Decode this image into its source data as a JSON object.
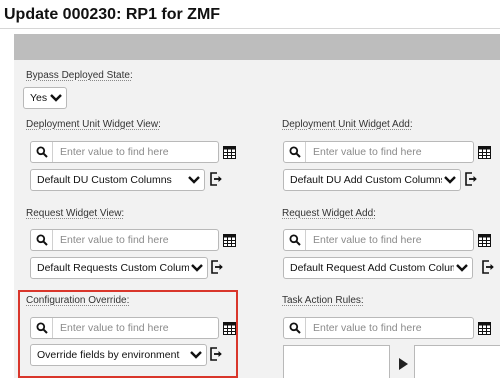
{
  "page": {
    "title": "Update  000230: RP1 for ZMF"
  },
  "bypass": {
    "label": "Bypass Deployed State:",
    "value": "Yes"
  },
  "du_view": {
    "label": "Deployment Unit Widget View:",
    "placeholder": "Enter value to find here",
    "selected": "Default DU Custom Columns"
  },
  "du_add": {
    "label": "Deployment Unit Widget Add:",
    "placeholder": "Enter value to find here",
    "selected": "Default DU Add Custom Columns"
  },
  "req_view": {
    "label": "Request Widget View:",
    "placeholder": "Enter value to find here",
    "selected": "Default Requests Custom Columns"
  },
  "req_add": {
    "label": "Request Widget Add:",
    "placeholder": "Enter value to find here",
    "selected": "Default Request Add Custom Columns"
  },
  "config_override": {
    "label": "Configuration Override:",
    "placeholder": "Enter value to find here",
    "selected": "Override fields by environment"
  },
  "task_action": {
    "label": "Task Action Rules:",
    "placeholder": "Enter value to find here"
  },
  "colors": {
    "highlight": "#d9362b",
    "header_band": "#bdbdbd",
    "panel": "#f2f2f2"
  },
  "icons": [
    "search-icon",
    "chevron-down-icon",
    "table-icon",
    "export-icon",
    "play-arrow-icon"
  ]
}
